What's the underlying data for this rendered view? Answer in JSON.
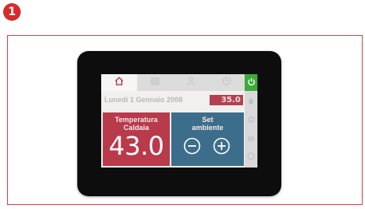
{
  "step_badge": "1",
  "tabs": [
    {
      "name": "home",
      "icon": "home-icon"
    },
    {
      "name": "heating",
      "icon": "radiator-icon"
    },
    {
      "name": "user",
      "icon": "user-icon"
    },
    {
      "name": "clock",
      "icon": "clock-icon"
    }
  ],
  "power_icon": "power-icon",
  "header": {
    "date": "Lunedì 1 Gennaio 2008",
    "outdoor_temp": "35.0"
  },
  "boiler": {
    "label_line1": "Temperatura",
    "label_line2": "Caldaia",
    "value": "43.0"
  },
  "setpoint": {
    "label_line1": "Set",
    "label_line2": "ambiente"
  },
  "colors": {
    "accent_red": "#b83a4b",
    "accent_blue": "#3c6e8c",
    "power_green": "#3daa3a",
    "frame_red": "#e04040"
  }
}
